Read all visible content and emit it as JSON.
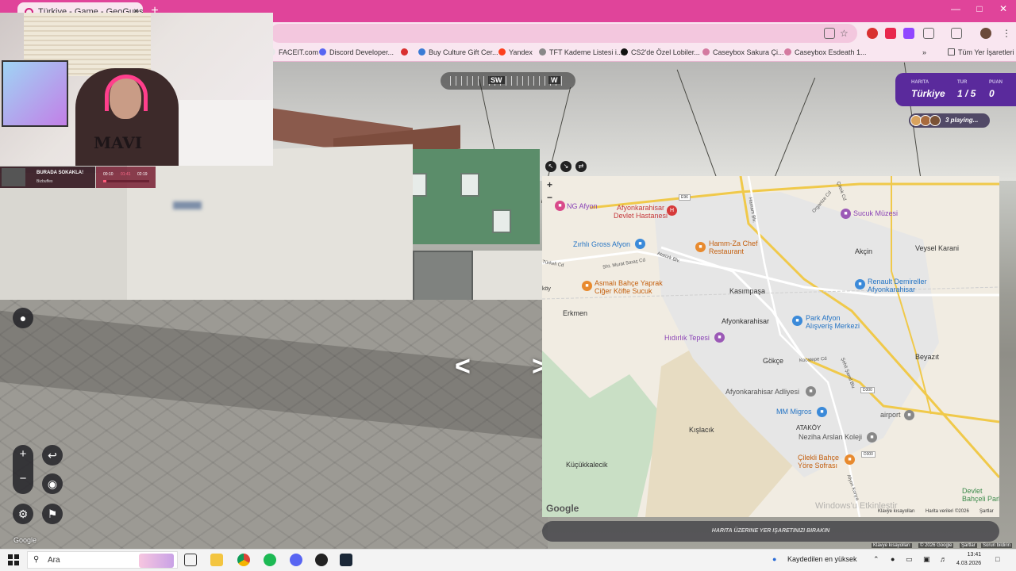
{
  "browser": {
    "tab_title": "Türkiye - Game - GeoGuessr",
    "tab_close": "×",
    "new_tab": "+",
    "bookmarks": [
      {
        "label": "FACEIT.com",
        "color": "#e8e8e8"
      },
      {
        "label": "Discord Developer...",
        "color": "#5865f2"
      },
      {
        "label": "",
        "color": "#d93030"
      },
      {
        "label": "Buy Culture Gift Cer...",
        "color": "#3a7bd5"
      },
      {
        "label": "Yandex",
        "color": "#fc3f1d"
      },
      {
        "label": "TFT Kademe Listesi i...",
        "color": "#888888"
      },
      {
        "label": "CS2'de Özel Lobiler...",
        "color": "#111111"
      },
      {
        "label": "Caseybox Sakura Çi...",
        "color": "#d47aa0"
      },
      {
        "label": "Caseybox Esdeath 1...",
        "color": "#d47aa0"
      }
    ],
    "bookmarks_more": "»",
    "all_bookmarks": "Tüm Yer İşaretleri"
  },
  "stream": {
    "now_playing_title": "BURADA SOKAKLA!",
    "now_playing_artist": "Bizbuffex",
    "time_elapsed": "00:10",
    "time_mid": "01:41",
    "time_total": "02:19",
    "progress": 0.07,
    "shirt_text": "MAVI"
  },
  "game": {
    "compass_sw": "SW",
    "compass_w": "W",
    "status": {
      "map_label": "HARITA",
      "map_value": "Türkiye",
      "round_label": "TUR",
      "round_value": "1 / 5",
      "score_label": "PUAN",
      "score_value": "0"
    },
    "playing": "3 playing...",
    "zoom_in": "+",
    "zoom_out": "−",
    "back": "↩",
    "guess_prompt": "HARITA ÜZERINE YER IŞARETINIZI BIRAKIN",
    "google_watermark": "Google",
    "map_footer": {
      "shortcuts": "Klavye kısayolları",
      "data": "Harita verileri ©2026",
      "terms": "Şartlar"
    },
    "page_footer": {
      "shortcuts": "Klavye kısayolları",
      "copyright": "© 2026 Google",
      "terms": "Şartlar",
      "report": "Sorun bildirin"
    }
  },
  "map": {
    "zoom_in": "+",
    "zoom_out": "−",
    "logo": "Google",
    "windows_watermark": "Windows'u Etkinleştir",
    "labels": {
      "ng_afyon": "NG Afyon",
      "hospital": "Afyonkarahisar\nDevlet Hastanesi",
      "sucuk": "Sucuk Müzesi",
      "zirhli": "Zırhlı Gross Afyon",
      "hamm": "Hamm-Za Chef\nRestaurant",
      "akcin": "Akçin",
      "veysel": "Veysel Karani",
      "asmali": "Asmalı Bahçe Yaprak\nCiğer Köfte Sucuk",
      "kasimpasa": "Kasımpaşa",
      "renault": "Renault Demireller\nAfyonkarahisar",
      "erkmen": "Erkmen",
      "afyon": "Afyonkarahisar",
      "park": "Park Afyon\nAlışveriş Merkezi",
      "hidirlik": "Hıdırlık Tepesi",
      "gokce": "Gökçe",
      "beyazit": "Beyazıt",
      "adliye": "Afyonkarahisar Adliyesi",
      "migros": "MM Migros",
      "airport": "airport",
      "kislacik": "Kışlacık",
      "atakoy": "ATAKÖY",
      "neziha": "Neziha Arslan Koleji",
      "kucukkalecik": "Küçükkalecik",
      "cilekli": "Çilekli Bahçe\nYöre Sofrası",
      "devlet_bahceli": "Devlet\nBahçeli Parkı",
      "koy": "köy"
    },
    "roads": {
      "ataturk": "Atatürk Blv.",
      "murat": "Sht. Murat Saraç Cd",
      "kocatepe": "Kocatepe Cd",
      "turkeli": "Türkeli Cd",
      "organize": "Organize Cd",
      "hamam": "Hamam Blv.",
      "sehit": "Şehit Şamil Blv.",
      "cikrik": "Çıkrık Cd",
      "afyon_konya": "Afyon Konya",
      "e96": "E96",
      "d300": "D300",
      "d300b": "D300"
    }
  },
  "taskbar": {
    "search": "Ara",
    "tray_weather": "Kaydedilen en yüksek",
    "time": "13:41",
    "date": "4.03.2026"
  }
}
